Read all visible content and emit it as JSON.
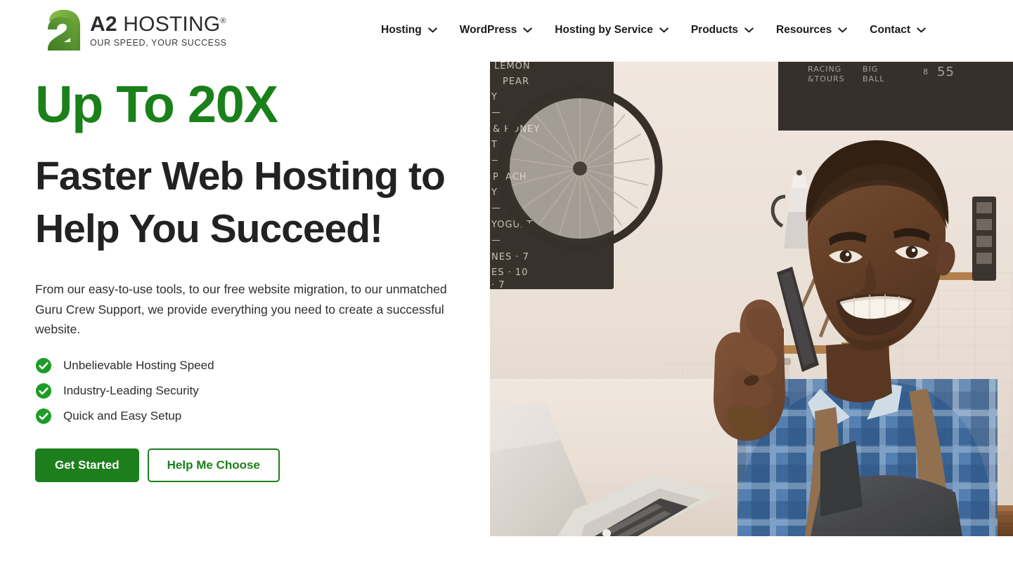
{
  "header": {
    "logo": {
      "mark": "a2-logo-mark",
      "brand_primary": "A2",
      "brand_secondary": "HOSTING",
      "registered_mark": "®",
      "tagline": "OUR SPEED, YOUR SUCCESS"
    },
    "nav": [
      {
        "label": "Hosting",
        "has_dropdown": true,
        "icon": "chevron-down-icon"
      },
      {
        "label": "WordPress",
        "has_dropdown": true,
        "icon": "chevron-down-icon"
      },
      {
        "label": "Hosting by Service",
        "has_dropdown": true,
        "icon": "chevron-down-icon"
      },
      {
        "label": "Products",
        "has_dropdown": true,
        "icon": "chevron-down-icon"
      },
      {
        "label": "Resources",
        "has_dropdown": true,
        "icon": "chevron-down-icon"
      },
      {
        "label": "Contact",
        "has_dropdown": true,
        "icon": "chevron-down-icon"
      }
    ]
  },
  "hero": {
    "eyebrow": "Up To 20X",
    "headline": "Faster Web Hosting to Help You Succeed!",
    "subtext": "From our easy-to-use tools, to our free website migration, to our unmatched Guru Crew Support, we provide everything you need to create a successful website.",
    "features": [
      {
        "icon": "check-circle-icon",
        "label": "Unbelievable Hosting Speed"
      },
      {
        "icon": "check-circle-icon",
        "label": "Industry-Leading Security"
      },
      {
        "icon": "check-circle-icon",
        "label": "Quick and Easy Setup"
      }
    ],
    "buttons": {
      "primary": "Get Started",
      "secondary": "Help Me Choose"
    },
    "image": {
      "name": "hero-photo",
      "alt": "Smiling small business owner talking on a mobile phone behind a cafe counter with an open laptop"
    }
  },
  "colors": {
    "brand_green": "#1a8019",
    "button_green": "#1c7f1c",
    "heading_dark": "#222222",
    "body_text": "#2d2d2d",
    "background": "#ffffff"
  }
}
